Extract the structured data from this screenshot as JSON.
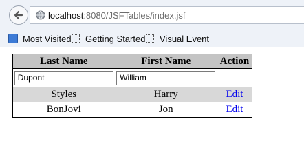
{
  "browser": {
    "url_host": "localhost",
    "url_rest": ":8080/JSFTables/index.jsf",
    "bookmarks": [
      {
        "label": "Most Visited"
      },
      {
        "label": "Getting Started"
      },
      {
        "label": "Visual Event"
      }
    ]
  },
  "table": {
    "headers": {
      "last_name": "Last Name",
      "first_name": "First Name",
      "action": "Action"
    },
    "new_row": {
      "last_name_value": "Dupont",
      "first_name_value": "William"
    },
    "rows": [
      {
        "last_name": "Styles",
        "first_name": "Harry",
        "action": "Edit"
      },
      {
        "last_name": "BonJovi",
        "first_name": "Jon",
        "action": "Edit"
      }
    ]
  }
}
